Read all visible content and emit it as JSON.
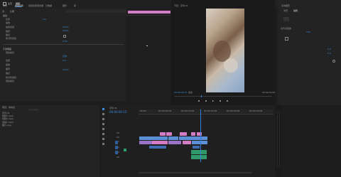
{
  "titlebar": {
    "tabs": [
      "主页",
      "编辑"
    ],
    "menu_items": [
      "项目",
      "效果控件",
      "音频剪辑混合器",
      "元数据"
    ],
    "right_items": [
      "图形",
      "库"
    ]
  },
  "effect_controls": {
    "source_label": "源",
    "sub_label": "主要",
    "section_motion": "运动",
    "section_opacity": "不透明度",
    "props": [
      {
        "name": "位置",
        "value": "0.0"
      },
      {
        "name": "缩放",
        "value": "100.0"
      },
      {
        "name": "缩放宽度",
        "value": "100.0"
      },
      {
        "name": "旋转",
        "value": "0.0"
      },
      {
        "name": "锚点",
        "value": "0.0"
      },
      {
        "name": "防闪烁滤镜",
        "value": "0.00"
      },
      {
        "name": "混合模式",
        "value": "正常"
      }
    ],
    "timecode": "00:00:00:00"
  },
  "source_monitor": {
    "clip_label": "视频",
    "handle_label": "00"
  },
  "program_monitor": {
    "title": "节目：序列 01",
    "timecode_left": "00:00:06:15",
    "timecode_right": "00:00:30:00",
    "fit_label": "适合"
  },
  "essential_panel": {
    "title": "基本图形",
    "tab_browse": "浏览",
    "tab_edit": "编辑",
    "section_label": "对齐并变换",
    "values": [
      "100",
      "0.0",
      "0.0"
    ]
  },
  "project_panel": {
    "title": "项目：未命名",
    "items": [
      "序列 01",
      "视频1.mp4",
      "视频2.mp4",
      "音频1.mp3",
      "图片.png"
    ]
  },
  "timeline": {
    "sequence_name": "序列 01",
    "timecode": "00:00:06:15",
    "ruler_marks": [
      "00:00",
      "00:00:05:00",
      "00:00:10:00",
      "00:00:15:00",
      "00:00:20:00",
      "00:00:25:00",
      "00:00:30:00"
    ],
    "tracks": [
      "V3",
      "V2",
      "V1",
      "A1",
      "A2",
      "A3"
    ]
  },
  "colors": {
    "accent": "#3d8de0",
    "clip_pink": "#d47cc4",
    "clip_purple": "#9a72c9",
    "clip_blue": "#5b8fd6",
    "clip_green": "#2f9b6a",
    "playhead": "#2f7fe0"
  }
}
